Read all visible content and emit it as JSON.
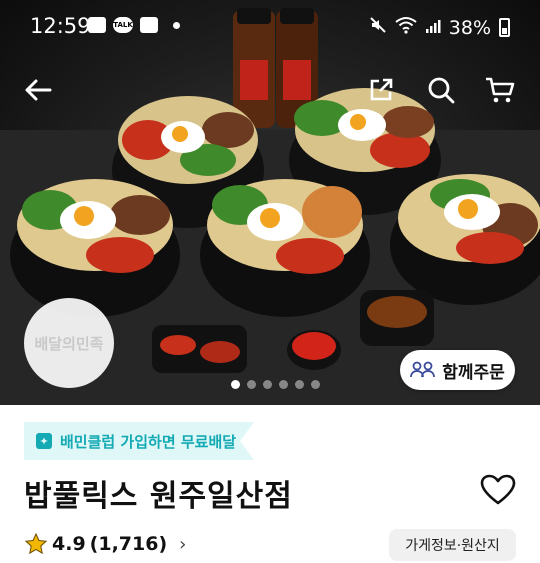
{
  "status_bar": {
    "time": "12:59",
    "battery": "38%"
  },
  "hero": {
    "logo_text": "배달의민족",
    "carousel": {
      "count": 6,
      "active": 1
    },
    "group_order_label": "함께주문"
  },
  "promo_banner": {
    "text": "배민클럽 가입하면 무료배달"
  },
  "store": {
    "name": "밥풀릭스 원주일산점",
    "rating": "4.9",
    "review_count": "(1,716)",
    "info_button": "가게정보·원산지"
  },
  "colors": {
    "accent": "#13aab4",
    "banner_bg": "#e0f7f8",
    "star": "#f2b705"
  }
}
